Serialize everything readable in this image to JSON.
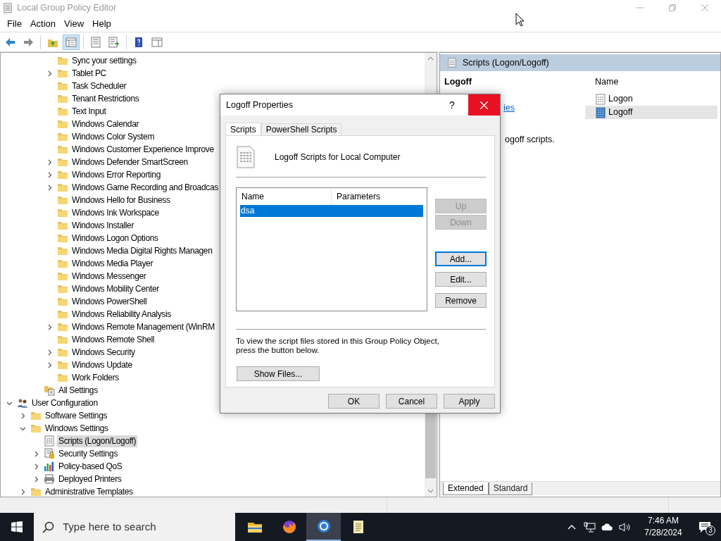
{
  "window": {
    "title": "Local Group Policy Editor"
  },
  "menu": [
    "File",
    "Action",
    "View",
    "Help"
  ],
  "toolbar": [
    {
      "kind": "back",
      "pressed": false
    },
    {
      "kind": "forward",
      "pressed": false
    },
    {
      "kind": "up",
      "pressed": false
    },
    {
      "kind": "tree",
      "pressed": true
    },
    {
      "kind": "properties",
      "pressed": false
    },
    {
      "kind": "export",
      "pressed": false
    },
    {
      "kind": "help",
      "pressed": false
    },
    {
      "kind": "view",
      "pressed": false
    }
  ],
  "tree": [
    {
      "children": [
        {
          "children": [
            {
              "children": [
                {
                  "label": "Sync your settings",
                  "kind": "folder",
                  "selected": false
                },
                {
                  "label": "Tablet PC",
                  "kind": "folder",
                  "expanded": false,
                  "selected": false
                },
                {
                  "label": "Task Scheduler",
                  "kind": "folder",
                  "selected": false
                },
                {
                  "label": "Tenant Restrictions",
                  "kind": "folder",
                  "selected": false
                },
                {
                  "label": "Text Input",
                  "kind": "folder",
                  "selected": false
                },
                {
                  "label": "Windows Calendar",
                  "kind": "folder",
                  "selected": false
                },
                {
                  "label": "Windows Color System",
                  "kind": "folder",
                  "selected": false
                },
                {
                  "label": "Windows Customer Experience Improve",
                  "kind": "folder",
                  "selected": false
                },
                {
                  "label": "Windows Defender SmartScreen",
                  "kind": "folder",
                  "expanded": false,
                  "selected": false
                },
                {
                  "label": "Windows Error Reporting",
                  "kind": "folder",
                  "expanded": false,
                  "selected": false
                },
                {
                  "label": "Windows Game Recording and Broadcas",
                  "kind": "folder",
                  "expanded": false,
                  "selected": false
                },
                {
                  "label": "Windows Hello for Business",
                  "kind": "folder",
                  "selected": false
                },
                {
                  "label": "Windows Ink Workspace",
                  "kind": "folder",
                  "selected": false
                },
                {
                  "label": "Windows Installer",
                  "kind": "folder",
                  "selected": false
                },
                {
                  "label": "Windows Logon Options",
                  "kind": "folder",
                  "selected": false
                },
                {
                  "label": "Windows Media Digital Rights Managen",
                  "kind": "folder",
                  "selected": false
                },
                {
                  "label": "Windows Media Player",
                  "kind": "folder",
                  "selected": false
                },
                {
                  "label": "Windows Messenger",
                  "kind": "folder",
                  "selected": false
                },
                {
                  "label": "Windows Mobility Center",
                  "kind": "folder",
                  "selected": false
                },
                {
                  "label": "Windows PowerShell",
                  "kind": "folder",
                  "selected": false
                },
                {
                  "label": "Windows Reliability Analysis",
                  "kind": "folder",
                  "selected": false
                },
                {
                  "label": "Windows Remote Management (WinRM",
                  "kind": "folder",
                  "expanded": false,
                  "selected": false
                },
                {
                  "label": "Windows Remote Shell",
                  "kind": "folder",
                  "selected": false
                },
                {
                  "label": "Windows Security",
                  "kind": "folder",
                  "expanded": false,
                  "selected": false
                },
                {
                  "label": "Windows Update",
                  "kind": "folder",
                  "expanded": false,
                  "selected": false
                },
                {
                  "label": "Work Folders",
                  "kind": "folder",
                  "selected": false
                }
              ]
            },
            {
              "label": "All Settings",
              "kind": "all-settings",
              "selected": false
            }
          ]
        }
      ]
    },
    {
      "label": "User Configuration",
      "kind": "user",
      "expanded": true,
      "selected": false,
      "children": [
        {
          "label": "Software Settings",
          "kind": "folder",
          "expanded": false,
          "selected": false
        },
        {
          "label": "Windows Settings",
          "kind": "folder",
          "expanded": true,
          "selected": false,
          "children": [
            {
              "label": "Scripts (Logon/Logoff)",
              "kind": "scripts",
              "selected": true
            },
            {
              "label": "Security Settings",
              "kind": "security",
              "expanded": false,
              "selected": false
            },
            {
              "label": "Policy-based QoS",
              "kind": "qos",
              "expanded": false,
              "selected": false
            },
            {
              "label": "Deployed Printers",
              "kind": "printer",
              "expanded": false,
              "selected": false
            }
          ]
        },
        {
          "label": "Administrative Templates",
          "kind": "folder",
          "expanded": false,
          "selected": false
        }
      ]
    }
  ],
  "details": {
    "header": "Scripts (Logon/Logoff)",
    "heading": "Logoff",
    "link": "ies",
    "description": "ogoff scripts.",
    "column": "Name",
    "items": [
      {
        "label": "Logon",
        "kind": "logon",
        "selected": false
      },
      {
        "label": "Logoff",
        "kind": "logoff",
        "selected": true
      }
    ],
    "tabs": [
      {
        "label": "Extended",
        "selected": true
      },
      {
        "label": "Standard",
        "selected": false
      }
    ]
  },
  "dialog": {
    "title": "Logoff Properties",
    "help": "?",
    "tabs": [
      {
        "label": "Scripts",
        "selected": true
      },
      {
        "label": "PowerShell Scripts",
        "selected": false
      }
    ],
    "heading": "Logoff Scripts for Local Computer",
    "columns": [
      "Name",
      "Parameters"
    ],
    "rows": [
      {
        "name": "dsa",
        "selected": true
      }
    ],
    "side_buttons": [
      {
        "label": "Up",
        "disabled": true,
        "focused": false
      },
      {
        "label": "Down",
        "disabled": true,
        "focused": false
      },
      {
        "label": "Add...",
        "disabled": false,
        "focused": true
      },
      {
        "label": "Edit...",
        "disabled": false,
        "focused": false
      },
      {
        "label": "Remove",
        "disabled": false,
        "focused": false
      }
    ],
    "note": "To view the script files stored in this Group Policy Object, press the button below.",
    "show_files": "Show Files...",
    "buttons": [
      "OK",
      "Cancel",
      "Apply"
    ]
  },
  "taskbar": {
    "search": {
      "placeholder": "Type here to search"
    },
    "apps": [
      {
        "kind": "explorer",
        "active": false
      },
      {
        "kind": "firefox",
        "active": false
      },
      {
        "kind": "chrome",
        "active": true
      },
      {
        "kind": "notepad",
        "active": false
      }
    ],
    "time": "7:46 AM",
    "date": "7/28/2024",
    "notifications": "3"
  }
}
